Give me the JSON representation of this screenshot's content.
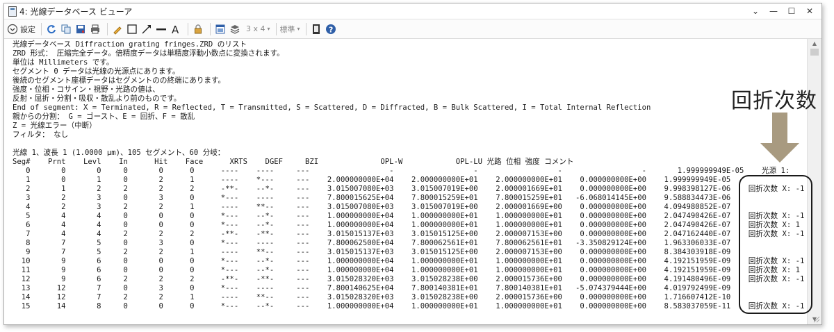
{
  "window": {
    "title": "4: 光線データベース ビューア",
    "controls": [
      "⌄",
      "—",
      "☐",
      "✕"
    ]
  },
  "toolbar": {
    "settings_label": "設定",
    "layout_label": "3 x 4",
    "standard_label": "標準",
    "icons": [
      "settings-toggle-icon",
      "refresh-icon",
      "copy-icon",
      "save-icon",
      "print-icon",
      "pencil-icon",
      "rectangle-icon",
      "arrow-tool-icon",
      "line-tool-icon",
      "text-tool-icon",
      "lock-icon",
      "window-icon",
      "layers-icon",
      "layout-dropdown",
      "standard-dropdown",
      "export-icon",
      "help-icon"
    ]
  },
  "content": {
    "header_lines": [
      "光線データベース Diffraction grating fringes.ZRD のリスト",
      "ZRD 形式： 圧縮完全データ。倍精度データは単精度浮動小数点に変換されます。",
      "単位は Millimeters です。",
      "セグメント 0 データは光線の光源点にあります。",
      "後続のセグメント座標データはセグメントのの終端にあります。",
      "強度・位相・コサイン・視野・光路の値は、",
      "反射・屈折・分割・吸収・散乱より前のものです。",
      "End of segment: X = Terminated, R = Reflected, T = Transmitted, S = Scattered, D = Diffracted, B = Bulk Scattered, I = Total Internal Reflection",
      "親からの分割： G = ゴースト、E = 回折、F = 散乱",
      "Z = 光線エラー（中断）",
      "フィルタ： なし",
      "",
      "光線 1、波長 1 (1.0000 μm)、105 セグメント、60 分岐："
    ],
    "table_header": "Seg#    Prnt    Levl    In      Hit    Face      XRTS    DGEF     BZI              OPL-W            OPL-LU 光路 位相 強度 コメント",
    "rows": [
      "   0       0       0     0       0      0      ----    ----     ---                  -                  -                  -                  -       1.999999949E-05    光源 1:",
      "   1       0       1     0       2      1      ----    *---     ---    2.000000000E+04    2.000000000E+01    2.000000000E+01    0.000000000E+00    1.999999949E-05",
      "   2       1       2     2       2      2      -**-    --*-     ---    3.015007080E+03    3.015007019E+00    2.000001669E+01    0.000000000E+00    9.998398127E-06    回折次数 X: -1",
      "   3       2       3     0       3      0      *---    ----     ---    7.800015625E+04    7.800015259E+01    7.800015259E+01   -6.068014145E+00    9.588834473E-06",
      "   4       2       3     2       2      1      ----    **--     ---    3.015007080E+03    3.015007019E+00    2.000001669E+00    0.000000000E+00    4.094980852E-07",
      "   5       4       4     0       0      0      *---    --*-     ---    1.000000000E+04    1.000000000E+01    1.000000000E+01    0.000000000E+00    2.047490426E-07    回折次数 X: -1",
      "   6       4       4     0       0      0      *---    --*-     ---    1.000000000E+04    1.000000000E+01    1.000000000E+01    0.000000000E+00    2.047490426E-07    回折次数 X: 1",
      "   7       4       4     2       2      2      -**-    -**-     ---    3.015015137E+03    3.015015125E+00    2.000007153E+00    0.000000000E+00    2.047162440E-07    回折次数 X: -1",
      "   8       7       5     0       3      0      *---    ----     ---    7.800062500E+04    7.800062561E+01    7.800062561E+01   -3.350829124E+00    1.963306033E-07",
      "   9       7       5     2       2      1      ----    **--     ---    3.015015137E+03    3.015015125E+00    2.000007153E+00    0.000000000E+00    8.384303918E-09",
      "  10       9       6     0       0      0      *---    --*-     ---    1.000000000E+04    1.000000000E+01    1.000000000E+01    0.000000000E+00    4.192151959E-09    回折次数 X: -1",
      "  11       9       6     0       0      0      *---    --*-     ---    1.000000000E+04    1.000000000E+01    1.000000000E+01    0.000000000E+00    4.192151959E-09    回折次数 X: 1",
      "  12       9       6     2       2      2      -**-    -**-     ---    3.015028320E+03    3.015028238E+00    2.000015736E+00    0.000000000E+00    4.191480496E-09    回折次数 X: -1",
      "  13      12       7     0       3      0      *---    ----     ---    7.800140625E+04    7.800140381E+01    7.800140381E+01   -5.074379444E+00    4.019792499E-09",
      "  14      12       7     2       2      1      ----    **--     ---    3.015028320E+03    3.015028238E+00    2.000015736E+00    0.000000000E+00    1.716607412E-10",
      "  15      14       8     0       0      0      *---    --*-     ---    1.000000000E+04    1.000000000E+01    1.000000000E+01    0.000000000E+00    8.583037059E-11    回折次数 X: -1"
    ]
  },
  "annotation": {
    "label": "回折次数",
    "arrow_color": "#a89a80",
    "box_color": "#1a1a1a"
  }
}
